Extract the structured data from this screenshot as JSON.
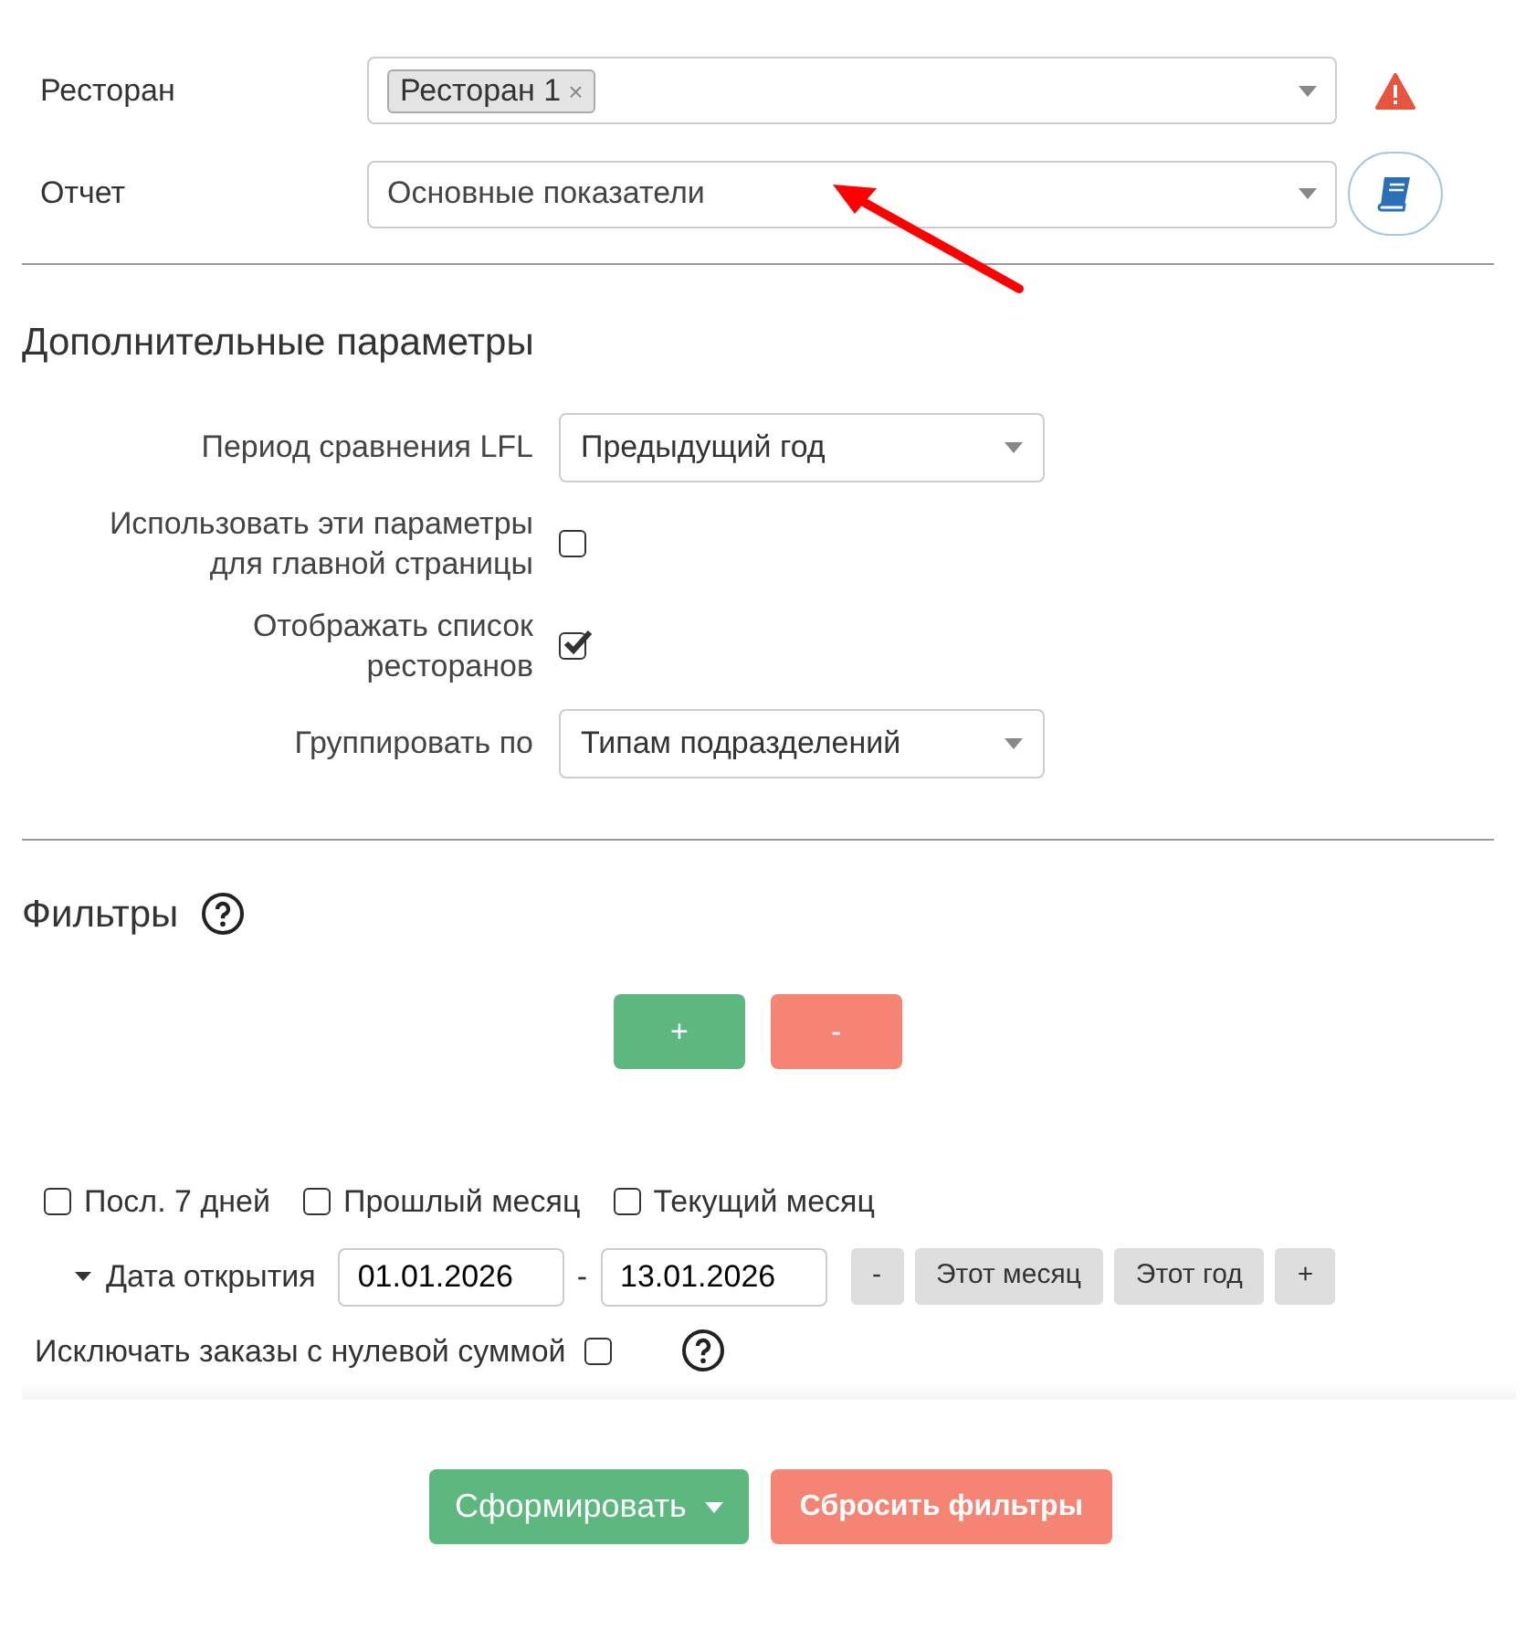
{
  "top_fields": [
    {
      "label": "Ресторан",
      "kind": "tags",
      "tags": [
        "Ресторан 1"
      ],
      "tag_remove": "×",
      "side": {
        "kind": "warning"
      }
    },
    {
      "label": "Отчет",
      "kind": "select",
      "value": "Основные показатели",
      "side": {
        "kind": "book"
      }
    }
  ],
  "extra": {
    "title": "Дополнительные параметры",
    "rows": [
      {
        "kind": "select",
        "label": "Период сравнения LFL",
        "value": "Предыдущий год"
      },
      {
        "kind": "checkbox",
        "label": "Использовать эти параметры для главной страницы",
        "checked": false
      },
      {
        "kind": "checkbox",
        "label": "Отображать список ресторанов",
        "checked": true
      },
      {
        "kind": "select",
        "label": "Группировать по",
        "value": "Типам подразделений"
      }
    ]
  },
  "filters": {
    "title": "Фильтры",
    "add": "+",
    "remove": "-"
  },
  "quick_periods": [
    {
      "label": "Посл. 7 дней",
      "checked": false
    },
    {
      "label": "Прошлый месяц",
      "checked": false
    },
    {
      "label": "Текущий месяц",
      "checked": false
    }
  ],
  "date_range": {
    "label": "Дата открытия",
    "from": "01.01.2026",
    "separator": "-",
    "to": "13.01.2026",
    "buttons": [
      "-",
      "Этот месяц",
      "Этот год",
      "+"
    ]
  },
  "exclude_zero": {
    "label": "Исключать заказы с нулевой суммой",
    "checked": false
  },
  "actions": {
    "submit": "Сформировать",
    "reset": "Сбросить фильтры"
  }
}
